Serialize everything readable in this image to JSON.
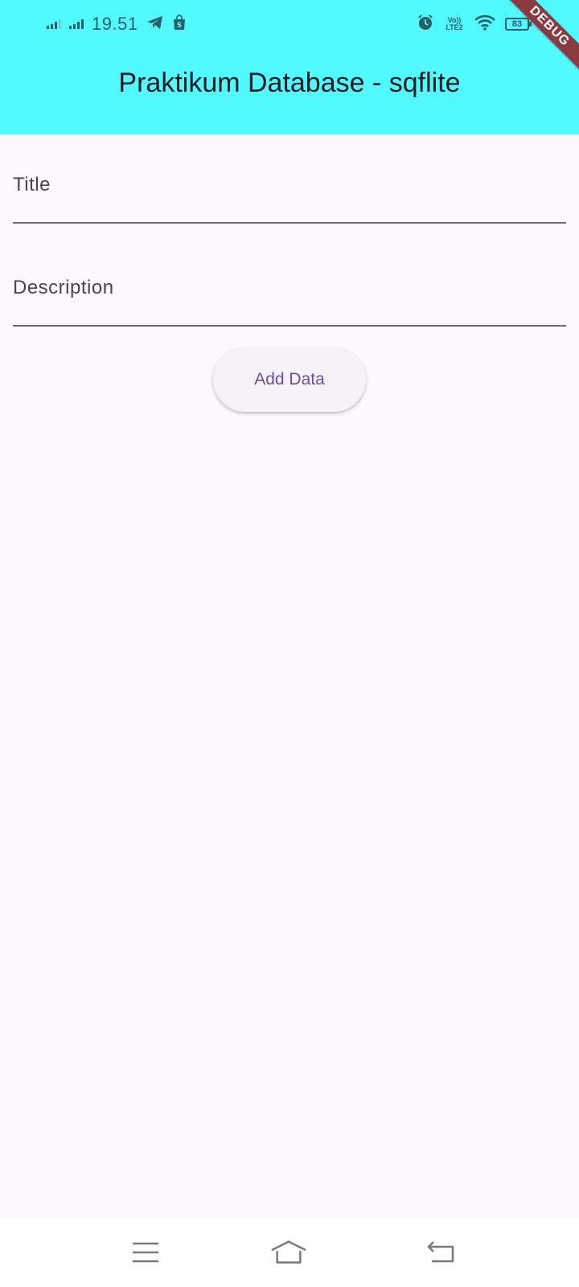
{
  "status_bar": {
    "time": "19.51",
    "network_label": "Vo)) LTE2",
    "battery_level": "83",
    "icons": [
      "signal-icon",
      "signal-icon",
      "telegram-icon",
      "shopee-icon",
      "alarm-icon",
      "volte-icon",
      "wifi-icon",
      "battery-icon"
    ]
  },
  "debug_banner": "DEBUG",
  "app_bar": {
    "title": "Praktikum Database - sqflite"
  },
  "form": {
    "title_placeholder": "Title",
    "title_value": "",
    "description_placeholder": "Description",
    "description_value": "",
    "add_button_label": "Add Data"
  },
  "nav_bar": {
    "icons": [
      "menu-icon",
      "home-icon",
      "back-icon"
    ]
  },
  "colors": {
    "app_bar_bg": "#4ff9fe",
    "page_bg": "#fdf7ff",
    "button_text": "#6750a4",
    "debug_banner": "#8b3b3f"
  }
}
